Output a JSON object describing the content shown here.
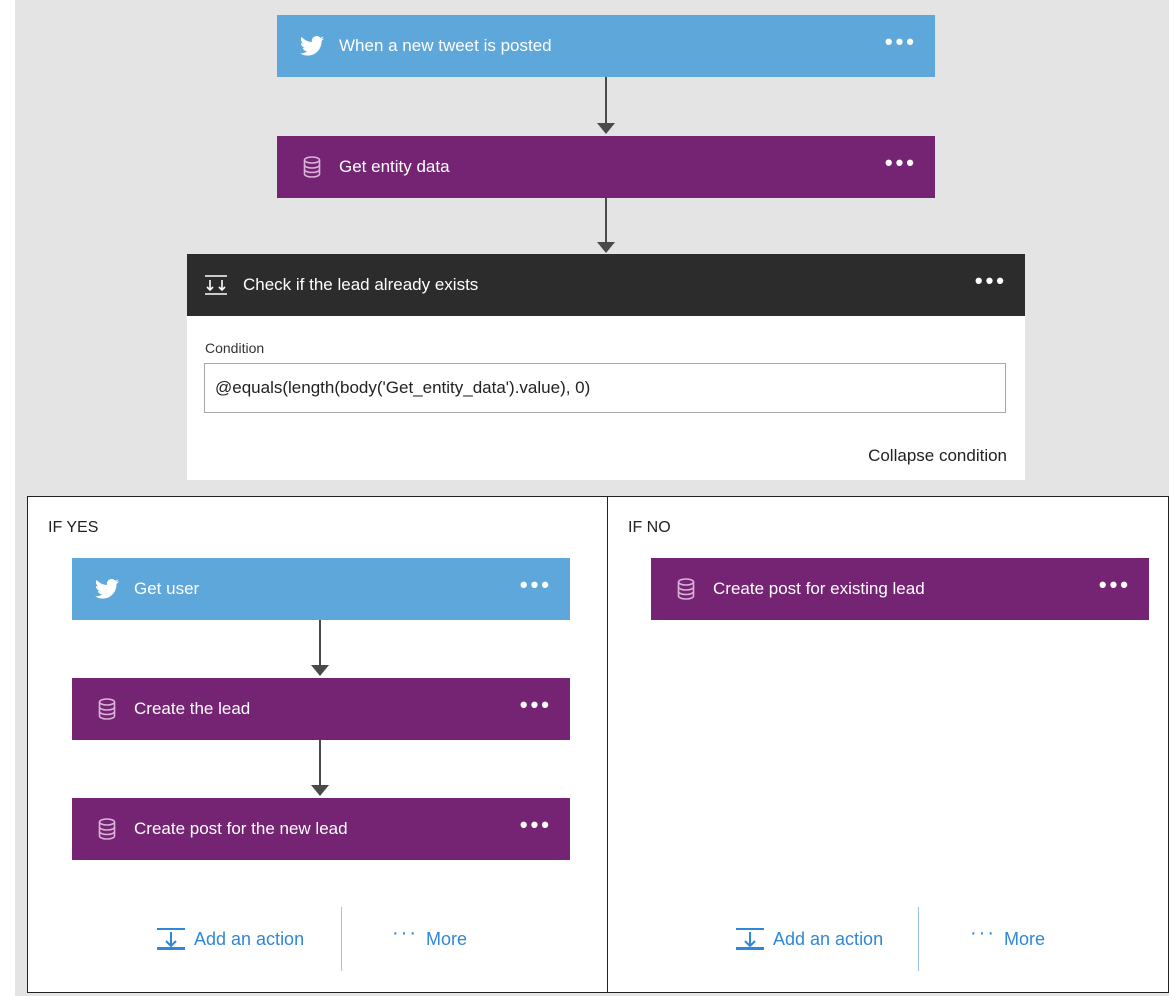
{
  "flow": {
    "trigger": {
      "label": "When a new tweet is posted",
      "icon": "twitter-icon"
    },
    "get_entity": {
      "label": "Get entity data",
      "icon": "database-icon"
    },
    "condition": {
      "label": "Check if the lead already exists",
      "icon": "condition-icon",
      "field_label": "Condition",
      "expression": "@equals(length(body('Get_entity_data').value), 0)",
      "collapse_label": "Collapse condition"
    },
    "menu_label": "•••"
  },
  "yes_branch": {
    "title": "IF YES",
    "steps": [
      {
        "label": "Get user",
        "icon": "twitter-icon"
      },
      {
        "label": "Create the lead",
        "icon": "database-icon"
      },
      {
        "label": "Create post for the new lead",
        "icon": "database-icon"
      }
    ],
    "add_action_label": "Add an action",
    "more_label": "More"
  },
  "no_branch": {
    "title": "IF NO",
    "steps": [
      {
        "label": "Create post for existing lead",
        "icon": "database-icon"
      }
    ],
    "add_action_label": "Add an action",
    "more_label": "More"
  },
  "colors": {
    "twitter": "#5ea7db",
    "purple": "#742472",
    "dark": "#2c2c2c",
    "link": "#2f87d9",
    "canvas": "#e4e4e4"
  }
}
